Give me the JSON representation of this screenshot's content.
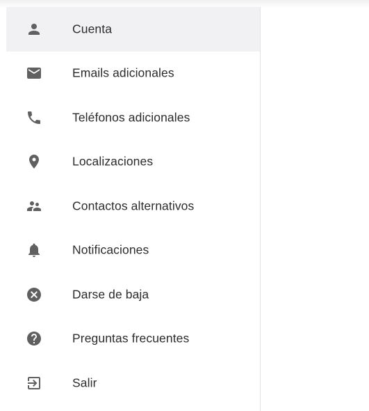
{
  "menu": {
    "items": [
      {
        "key": "cuenta",
        "label": "Cuenta",
        "icon": "person-icon",
        "active": true
      },
      {
        "key": "emails",
        "label": "Emails adicionales",
        "icon": "mail-icon",
        "active": false
      },
      {
        "key": "telefonos",
        "label": "Teléfonos adicionales",
        "icon": "phone-icon",
        "active": false
      },
      {
        "key": "localizaciones",
        "label": "Localizaciones",
        "icon": "location-pin-icon",
        "active": false
      },
      {
        "key": "contactos",
        "label": "Contactos alternativos",
        "icon": "people-icon",
        "active": false
      },
      {
        "key": "notificaciones",
        "label": "Notificaciones",
        "icon": "bell-icon",
        "active": false
      },
      {
        "key": "baja",
        "label": "Darse de baja",
        "icon": "cancel-circle-icon",
        "active": false
      },
      {
        "key": "faq",
        "label": "Preguntas frecuentes",
        "icon": "help-circle-icon",
        "active": false
      },
      {
        "key": "salir",
        "label": "Salir",
        "icon": "logout-icon",
        "active": false
      }
    ],
    "active_background": "#f1f1f4",
    "icon_color": "#606060",
    "text_color": "#2c2c2c"
  }
}
